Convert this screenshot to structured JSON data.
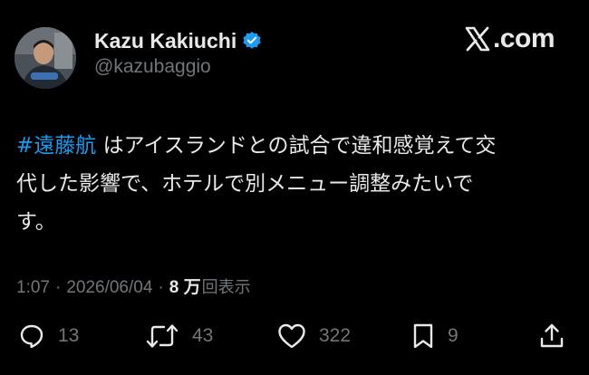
{
  "author": {
    "display_name": "Kazu Kakiuchi",
    "handle": "@kazubaggio",
    "verified": true
  },
  "source": {
    "domain": ".com",
    "logo_icon": "x-logo-icon"
  },
  "tweet": {
    "hashtag": "#遠藤航",
    "line1_rest": " はアイスランドとの試合で違和感覚えて交",
    "line2": "代した影響で、ホテルで別メニュー調整みたいで",
    "line3": "す。"
  },
  "meta": {
    "time": "1:07",
    "separator": "·",
    "date": "2026/06/04",
    "views_count": "8 万",
    "views_label": "回表示"
  },
  "actions": {
    "replies": "13",
    "reposts": "43",
    "likes": "322",
    "bookmarks": "9"
  },
  "colors": {
    "background": "#000000",
    "text": "#e7e9ea",
    "muted": "#71767b",
    "accent": "#1d9bf0"
  }
}
